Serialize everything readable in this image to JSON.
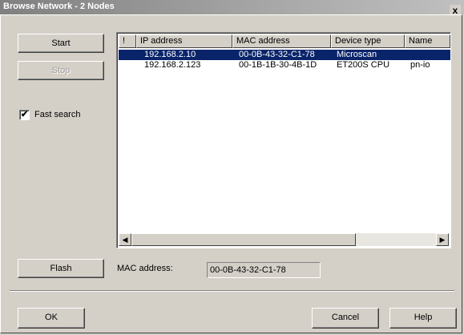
{
  "window": {
    "title": "Browse Network - 2 Nodes",
    "close_glyph": "x"
  },
  "buttons": {
    "start": "Start",
    "stop": "Stop",
    "flash": "Flash",
    "ok": "OK",
    "cancel": "Cancel",
    "help": "Help"
  },
  "fast_search": {
    "label": "Fast search",
    "checked": true,
    "mark": "✔"
  },
  "list": {
    "columns": [
      "!",
      "IP address",
      "MAC address",
      "Device type",
      "Name"
    ],
    "rows": [
      {
        "flag": "",
        "ip": "192.168.2.10",
        "mac": "00-0B-43-32-C1-78",
        "type": "Microscan",
        "name": "",
        "selected": true
      },
      {
        "flag": "",
        "ip": "192.168.2.123",
        "mac": "00-1B-1B-30-4B-1D",
        "type": "ET200S CPU",
        "name": "pn-io",
        "selected": false
      }
    ],
    "scroll_left_glyph": "◀",
    "scroll_right_glyph": "▶"
  },
  "mac_address": {
    "label": "MAC address:",
    "value": "00-0B-43-32-C1-78"
  }
}
